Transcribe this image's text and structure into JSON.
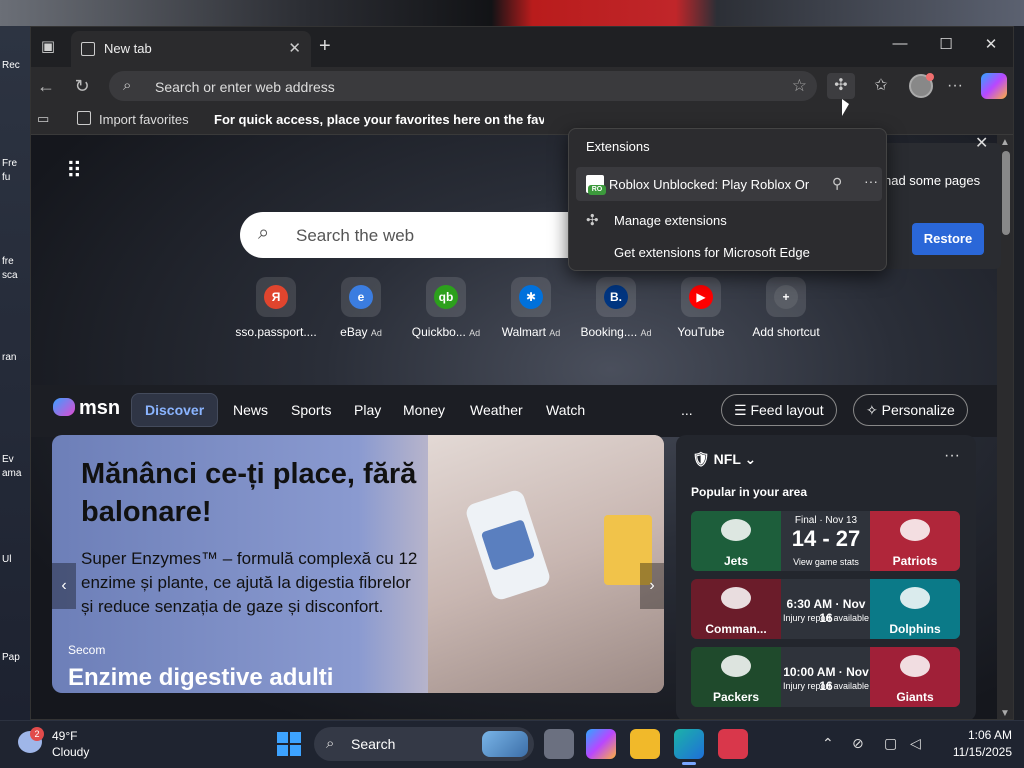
{
  "desktop": {
    "icons": [
      "Rec",
      "Fre",
      "fu",
      "fre",
      "sca",
      "ran",
      "Ev",
      "ama",
      "Ul",
      "Pap"
    ]
  },
  "browser": {
    "tab_title": "New tab",
    "address_placeholder": "Search or enter web address",
    "favorites_bar": {
      "import_label": "Import favorites",
      "hint": "For quick access, place your favorites here on the favorites bar."
    }
  },
  "extensions_menu": {
    "title": "Extensions",
    "items": [
      {
        "name": "Roblox Unblocked: Play Roblox Onli...",
        "badge": "RO"
      }
    ],
    "manage_label": "Manage extensions",
    "get_label": "Get extensions for Microsoft Edge"
  },
  "restore_panel": {
    "message": "had some pages",
    "button_label": "Restore"
  },
  "ntp": {
    "search_placeholder": "Search the web",
    "shortcuts": [
      {
        "label": "sso.passport....",
        "ad": "",
        "color": "#e0452e",
        "glyph": "Я"
      },
      {
        "label": "eBay",
        "ad": "Ad",
        "color": "#3b7de0",
        "glyph": "e"
      },
      {
        "label": "Quickbo...",
        "ad": "Ad",
        "color": "#2ca01c",
        "glyph": "qb"
      },
      {
        "label": "Walmart",
        "ad": "Ad",
        "color": "#0071dc",
        "glyph": "✱"
      },
      {
        "label": "Booking....",
        "ad": "Ad",
        "color": "#003580",
        "glyph": "B."
      },
      {
        "label": "YouTube",
        "ad": "",
        "color": "#ff0000",
        "glyph": "▶"
      },
      {
        "label": "Add shortcut",
        "ad": "",
        "color": "#5a5e66",
        "glyph": "+"
      }
    ]
  },
  "msn": {
    "logo": "msn",
    "tabs": [
      "Discover",
      "News",
      "Sports",
      "Play",
      "Money",
      "Weather",
      "Watch"
    ],
    "more": "...",
    "feed_layout": "Feed layout",
    "personalize": "Personalize"
  },
  "hero": {
    "headline": "Mănânci ce-ți place, fără balonare!",
    "body": "Super Enzymes™ – formulă complexă cu 12 enzime și plante, ce ajută la digestia fibrelor și reduce senzația de gaze și disconfort.",
    "source": "Secom",
    "caption": "Enzime digestive adulti"
  },
  "sports": {
    "league": "NFL",
    "subtitle": "Popular in your area",
    "games": [
      {
        "left": "Jets",
        "right": "Patriots",
        "status": "Final · Nov 13",
        "score": "14 - 27",
        "note": "View game stats",
        "lcolor": "#1d5e3b",
        "rcolor": "#b0263a"
      },
      {
        "left": "Comman...",
        "right": "Dolphins",
        "status": "",
        "score": "6:30 AM · Nov 16",
        "note": "Injury report available",
        "lcolor": "#6b1c2a",
        "rcolor": "#0b7a88"
      },
      {
        "left": "Packers",
        "right": "Giants",
        "status": "",
        "score": "10:00 AM · Nov 16",
        "note": "Injury report available",
        "lcolor": "#1f4a2c",
        "rcolor": "#a02038"
      }
    ]
  },
  "taskbar": {
    "weather_temp": "49°F",
    "weather_cond": "Cloudy",
    "weather_badge": "2",
    "search_label": "Search",
    "time": "1:06 AM",
    "date": "11/15/2025"
  }
}
